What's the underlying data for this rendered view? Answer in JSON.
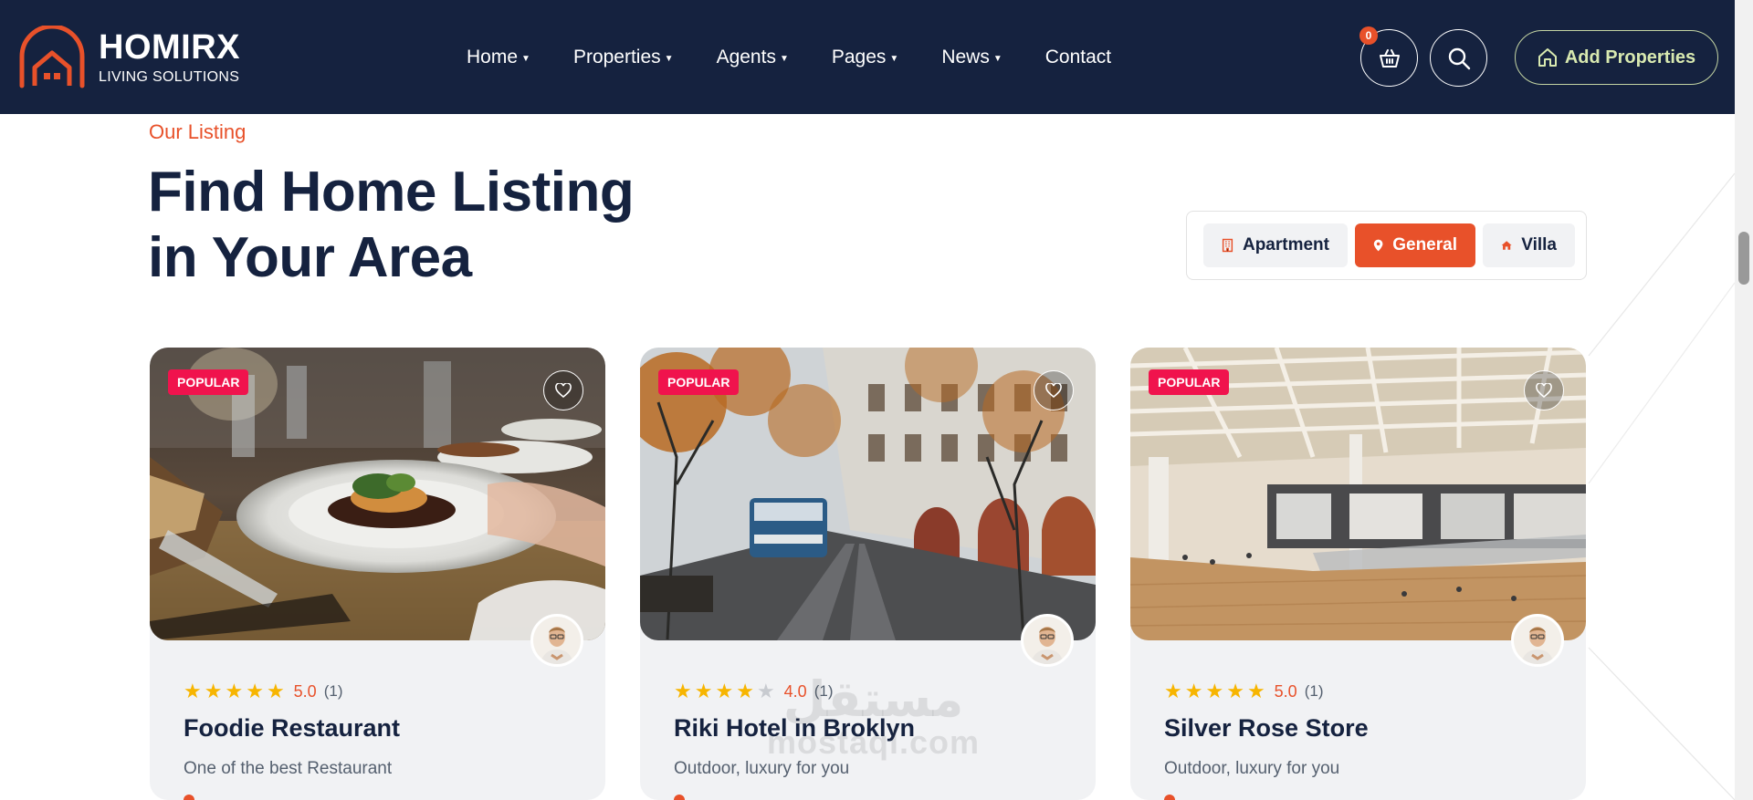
{
  "brand": {
    "name": "HOMIRX",
    "tagline": "LIVING SOLUTIONS",
    "accent": "#e8512a",
    "navy": "#15223f"
  },
  "nav": {
    "items": [
      {
        "label": "Home",
        "has_dropdown": true
      },
      {
        "label": "Properties",
        "has_dropdown": true
      },
      {
        "label": "Agents",
        "has_dropdown": true
      },
      {
        "label": "Pages",
        "has_dropdown": true
      },
      {
        "label": "News",
        "has_dropdown": true
      },
      {
        "label": "Contact",
        "has_dropdown": false
      }
    ]
  },
  "header_actions": {
    "cart_count": "0",
    "cart_icon": "basket-icon",
    "search_icon": "search-icon",
    "add_label": "Add Properties"
  },
  "section": {
    "eyebrow": "Our Listing",
    "headline_line1": "Find Home Listing",
    "headline_line2": "in Your Area"
  },
  "tabs": [
    {
      "label": "Apartment",
      "icon": "building-icon",
      "active": false
    },
    {
      "label": "General",
      "icon": "map-pin-icon",
      "active": true
    },
    {
      "label": "Villa",
      "icon": "home-icon",
      "active": false
    }
  ],
  "cards": [
    {
      "badge": "POPULAR",
      "rating": 5,
      "rating_label": "5.0",
      "reviews": "(1)",
      "title": "Foodie Restaurant",
      "desc": "One of the best Restaurant"
    },
    {
      "badge": "POPULAR",
      "rating": 4,
      "rating_label": "4.0",
      "reviews": "(1)",
      "title": "Riki Hotel in Broklyn",
      "desc": "Outdoor, luxury for you"
    },
    {
      "badge": "POPULAR",
      "rating": 5,
      "rating_label": "5.0",
      "reviews": "(1)",
      "title": "Silver Rose Store",
      "desc": "Outdoor, luxury for you"
    }
  ],
  "watermark": {
    "line1": "مستقل",
    "line2": "mostaql.com"
  }
}
